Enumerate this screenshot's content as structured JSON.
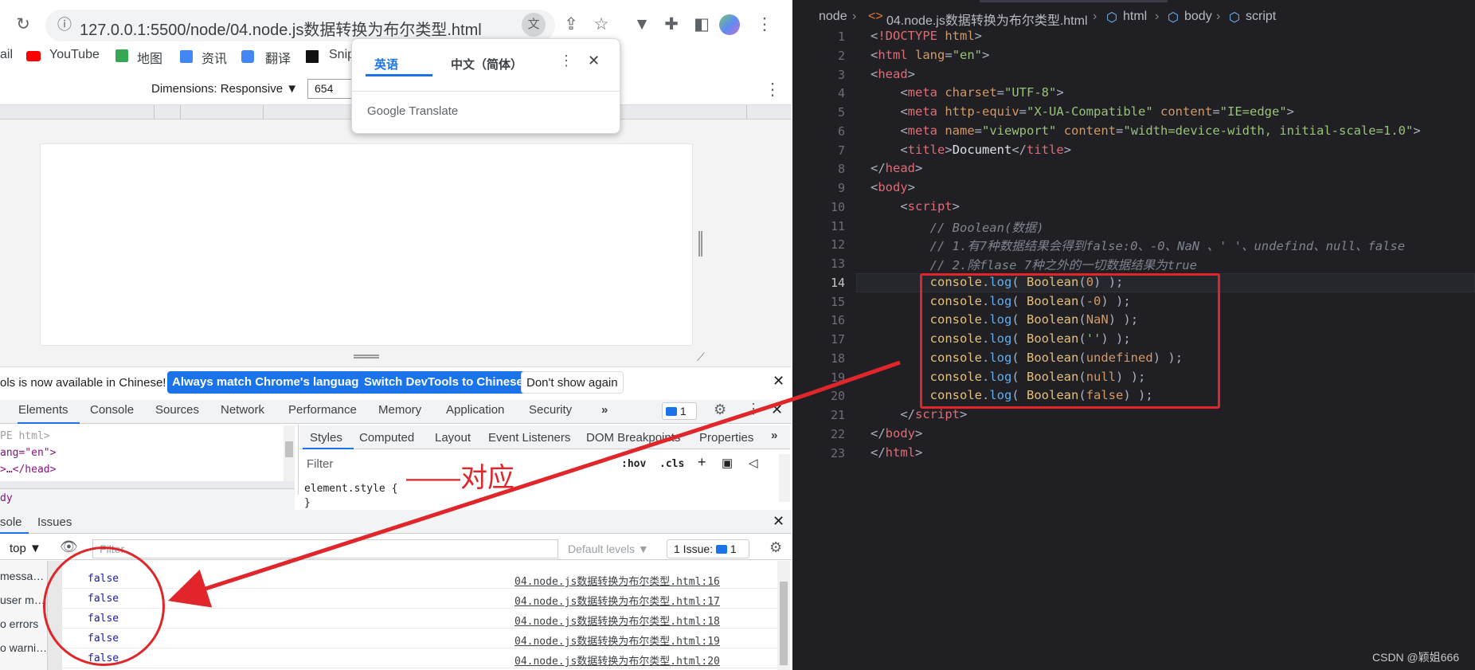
{
  "browser": {
    "url": "127.0.0.1:5500/node/04.node.js数据转换为布尔类型.html",
    "bookmarks": [
      "ail",
      "YouTube",
      "地图",
      "资讯",
      "翻译",
      "Snip"
    ],
    "devtools": {
      "dimensions_label": "Dimensions: Responsive ▼",
      "width_value": "654",
      "infobar_text": "ols is now available in Chinese!",
      "always_match_button": "Always match Chrome's language",
      "switch_button": "Switch DevTools to Chinese",
      "dont_show_button": "Don't show again",
      "tabs": [
        "Elements",
        "Console",
        "Sources",
        "Network",
        "Performance",
        "Memory",
        "Application",
        "Security"
      ],
      "issue_count": "1",
      "elements_lines": [
        "PE html>",
        "ang=\"en\">",
        ">…</head>"
      ],
      "elements_breadcrumb": "dy",
      "styles_tabs": [
        "Styles",
        "Computed",
        "Layout",
        "Event Listeners",
        "DOM Breakpoints",
        "Properties"
      ],
      "filter_placeholder": "Filter",
      "hov_label": ":hov",
      "cls_label": ".cls",
      "element_style": "element.style {",
      "element_style_close": "}",
      "drawer_tabs": [
        "sole",
        "Issues"
      ],
      "context_label": "top ▼",
      "console_filter_placeholder": "Filter",
      "levels_label": "Default levels ▼",
      "issue_badge": "1 Issue:",
      "issue_badge_count": "1",
      "sidebar_items": [
        "messa…",
        "user m…",
        "o errors",
        "o warni…"
      ],
      "console_rows": [
        {
          "value": "false",
          "source": "04.node.js数据转换为布尔类型.html:16"
        },
        {
          "value": "false",
          "source": "04.node.js数据转换为布尔类型.html:17"
        },
        {
          "value": "false",
          "source": "04.node.js数据转换为布尔类型.html:18"
        },
        {
          "value": "false",
          "source": "04.node.js数据转换为布尔类型.html:19"
        },
        {
          "value": "false",
          "source": "04.node.js数据转换为布尔类型.html:20"
        }
      ]
    },
    "translate_popup": {
      "lang_active": "英语",
      "lang_other": "中文（简体）",
      "brand": "Google Translate"
    }
  },
  "annotation": {
    "label": "——对应",
    "color": "#e0262a"
  },
  "editor": {
    "breadcrumb": [
      "node",
      "04.node.js数据转换为布尔类型.html",
      "html",
      "body",
      "script"
    ],
    "lines": [
      "1",
      "2",
      "3",
      "4",
      "5",
      "6",
      "7",
      "8",
      "9",
      "10",
      "11",
      "12",
      "13",
      "14",
      "15",
      "16",
      "17",
      "18",
      "19",
      "20",
      "21",
      "22",
      "23"
    ],
    "code": {
      "l1": "<!DOCTYPE html>",
      "l12": "// 1.有7种数据结果会得到false:0、-0、NaN 、' '、undefind、null、false",
      "l11": "// Boolean(数据)",
      "l13": "// 2.除flase 7种之外的一切数据结果为true"
    },
    "watermark": "CSDN @颖姐666"
  }
}
